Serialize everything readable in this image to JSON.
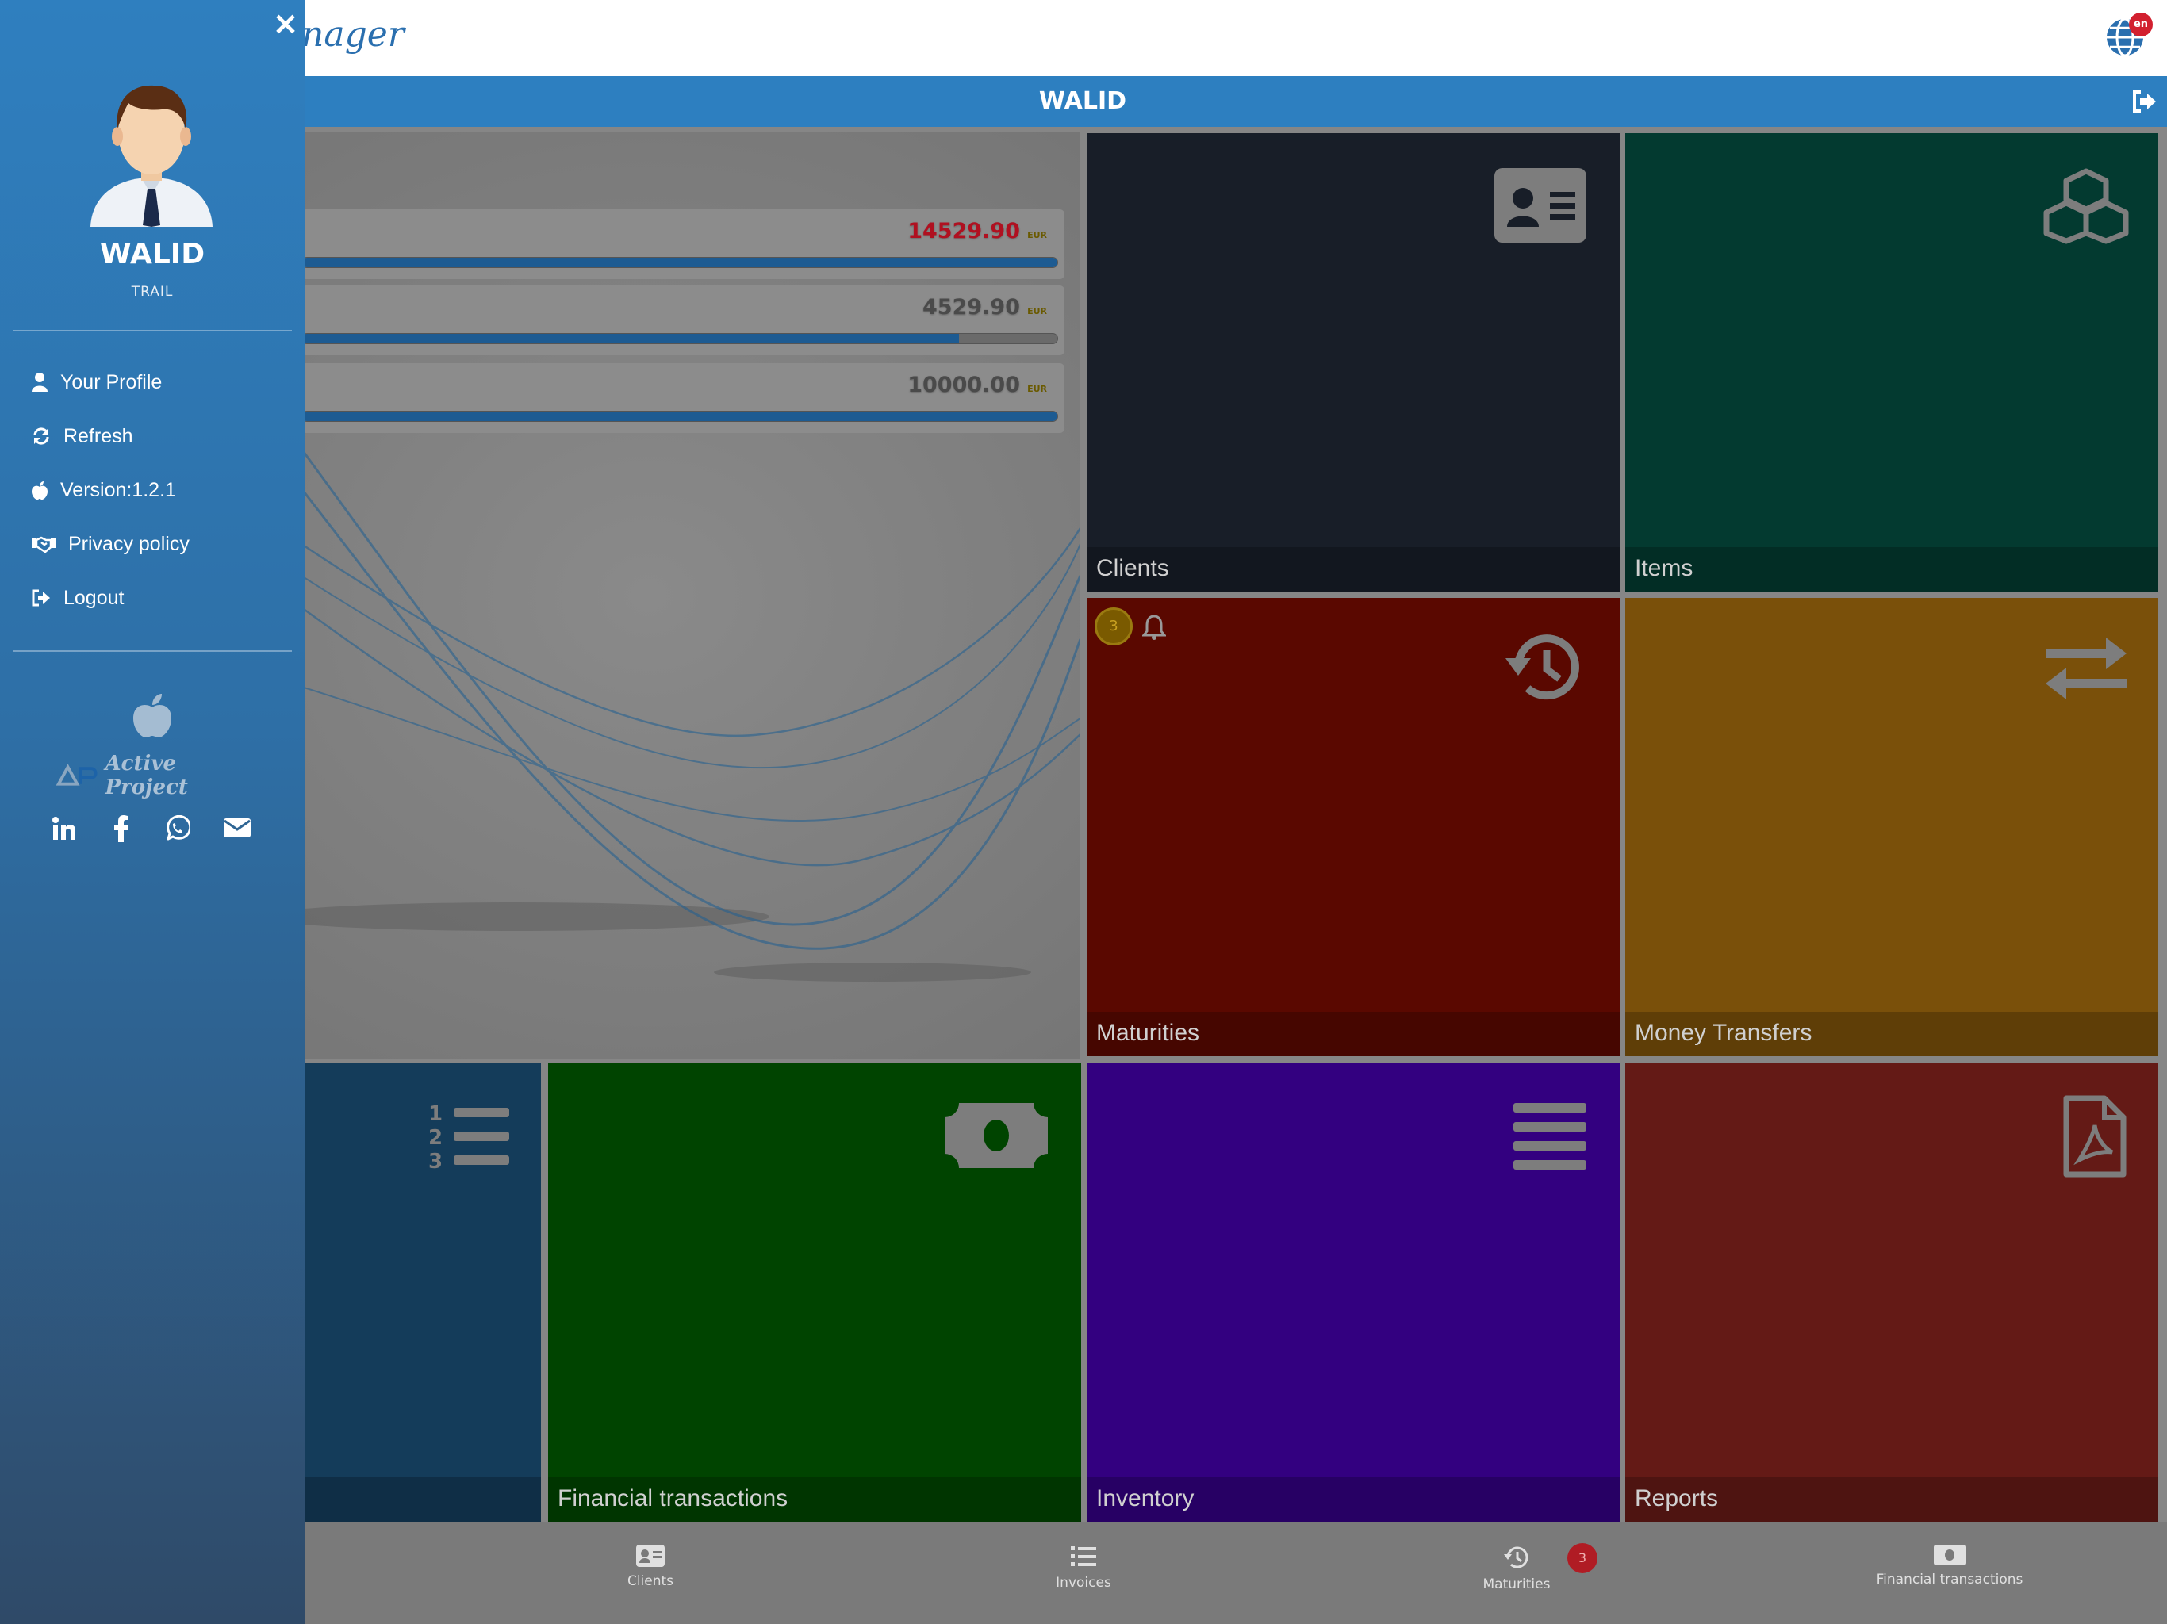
{
  "header": {
    "brand_fragment": "nager",
    "language_badge": "en",
    "user_name": "WALID"
  },
  "balances": [
    {
      "amount": "14529.90",
      "currency": "EUR",
      "amount_color": "#b01020",
      "progress": 1.0
    },
    {
      "amount": "4529.90",
      "currency": "EUR",
      "amount_color": "#4a4a4a",
      "progress": 0.87
    },
    {
      "amount": "10000.00",
      "currency": "EUR",
      "amount_color": "#4a4a4a",
      "progress": 1.0
    }
  ],
  "tiles": {
    "clients": {
      "label": "Clients",
      "color": "#181e28",
      "icon": "contact-card-icon"
    },
    "items": {
      "label": "Items",
      "color": "#033a30",
      "icon": "cubes-icon"
    },
    "maturities": {
      "label": "Maturities",
      "color": "#5a0800",
      "icon": "history-icon",
      "badge": "3"
    },
    "money_transfers": {
      "label": "Money Transfers",
      "color": "#7a500a",
      "icon": "exchange-arrows-icon"
    },
    "invoices": {
      "label": "",
      "color": "#143c5a",
      "icon": "numbered-list-icon"
    },
    "financial_transactions": {
      "label": "Financial transactions",
      "color": "#004400",
      "icon": "banknote-icon"
    },
    "inventory": {
      "label": "Inventory",
      "color": "#330080",
      "icon": "list-lines-icon"
    },
    "reports": {
      "label": "Reports",
      "color": "#641a16",
      "icon": "pdf-file-icon"
    }
  },
  "bottom_nav": [
    {
      "label": "Clients",
      "icon": "contact-card-icon"
    },
    {
      "label": "Invoices",
      "icon": "numbered-list-icon"
    },
    {
      "label": "Maturities",
      "icon": "history-icon",
      "badge": "3"
    },
    {
      "label": "Financial transactions",
      "icon": "banknote-icon"
    }
  ],
  "drawer": {
    "name": "WALID",
    "role": "TRAIL",
    "menu": [
      {
        "label": "Your Profile",
        "icon": "user-icon"
      },
      {
        "label": "Refresh",
        "icon": "refresh-icon"
      },
      {
        "label": "Version:1.2.1",
        "icon": "apple-icon"
      },
      {
        "label": "Privacy policy",
        "icon": "handshake-icon"
      },
      {
        "label": "Logout",
        "icon": "logout-icon"
      }
    ],
    "company": "Active Project",
    "social": [
      "linkedin-icon",
      "facebook-icon",
      "whatsapp-icon",
      "email-icon"
    ]
  },
  "colors": {
    "accent": "#2d7fc0",
    "drawer_top": "#2f7fbf",
    "drawer_bottom": "#2f4a68"
  }
}
